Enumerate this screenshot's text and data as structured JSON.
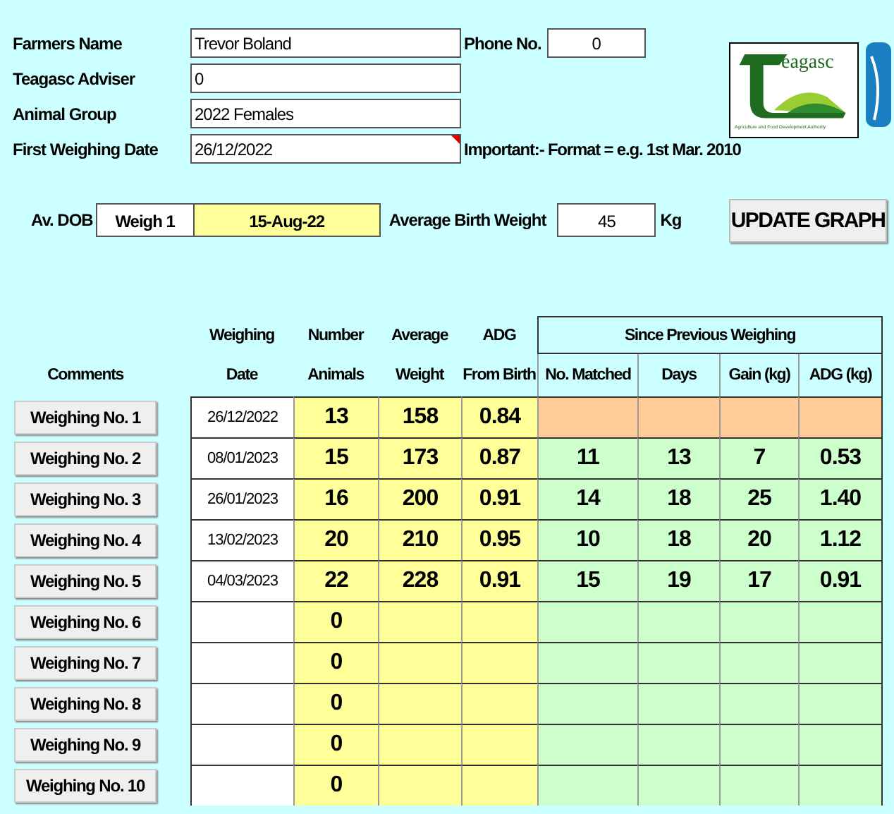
{
  "form": [
    {
      "label": "Farmers Name",
      "value": "Trevor Boland"
    },
    {
      "label": "Teagasc Adviser",
      "value": "0"
    },
    {
      "label": "Animal Group",
      "value": "2022 Females"
    },
    {
      "label": "First Weighing Date",
      "value": "26/12/2022",
      "commented": true,
      "note": "Important:- Format = e.g. 1st Mar. 2010"
    }
  ],
  "phone": {
    "label": "Phone No.",
    "value": "0"
  },
  "logo": {
    "wordmark": "eagasc",
    "subtitle": "Agriculture and Food Development Authority"
  },
  "dob": {
    "label": "Av. DOB",
    "source": "Weigh 1",
    "value": "15-Aug-22"
  },
  "birth_weight": {
    "label": "Average Birth Weight",
    "value": "45",
    "unit": "Kg"
  },
  "update_button": "UPDATE GRAPH",
  "table": {
    "comments_header": "Comments",
    "columns": [
      {
        "line1": "Weighing",
        "line2": "Date"
      },
      {
        "line1": "Number",
        "line2": "Animals"
      },
      {
        "line1": "Average",
        "line2": "Weight"
      },
      {
        "line1": "ADG",
        "line2": "From Birth"
      }
    ],
    "group_header": "Since Previous Weighing",
    "group_columns": [
      "No. Matched",
      "Days",
      "Gain (kg)",
      "ADG (kg)"
    ],
    "rows": [
      {
        "button": "Weighing No. 1",
        "kind": "first",
        "date": "26/12/2022",
        "number": "13",
        "weight": "158",
        "adg": "0.84",
        "since": []
      },
      {
        "button": "Weighing No. 2",
        "kind": "later",
        "date": "08/01/2023",
        "number": "15",
        "weight": "173",
        "adg": "0.87",
        "since": [
          "11",
          "13",
          "7",
          "0.53"
        ]
      },
      {
        "button": "Weighing No. 3",
        "kind": "later",
        "date": "26/01/2023",
        "number": "16",
        "weight": "200",
        "adg": "0.91",
        "since": [
          "14",
          "18",
          "25",
          "1.40"
        ]
      },
      {
        "button": "Weighing No. 4",
        "kind": "later",
        "date": "13/02/2023",
        "number": "20",
        "weight": "210",
        "adg": "0.95",
        "since": [
          "10",
          "18",
          "20",
          "1.12"
        ]
      },
      {
        "button": "Weighing No. 5",
        "kind": "later",
        "date": "04/03/2023",
        "number": "22",
        "weight": "228",
        "adg": "0.91",
        "since": [
          "15",
          "19",
          "17",
          "0.91"
        ]
      },
      {
        "button": "Weighing No. 6",
        "kind": "later",
        "number": "0",
        "since": []
      },
      {
        "button": "Weighing No. 7",
        "kind": "later",
        "number": "0",
        "since": []
      },
      {
        "button": "Weighing No. 8",
        "kind": "later",
        "number": "0",
        "since": []
      },
      {
        "button": "Weighing No. 9",
        "kind": "later",
        "number": "0",
        "since": []
      },
      {
        "button": "Weighing No. 10",
        "kind": "later",
        "number": "0",
        "since": []
      }
    ]
  }
}
